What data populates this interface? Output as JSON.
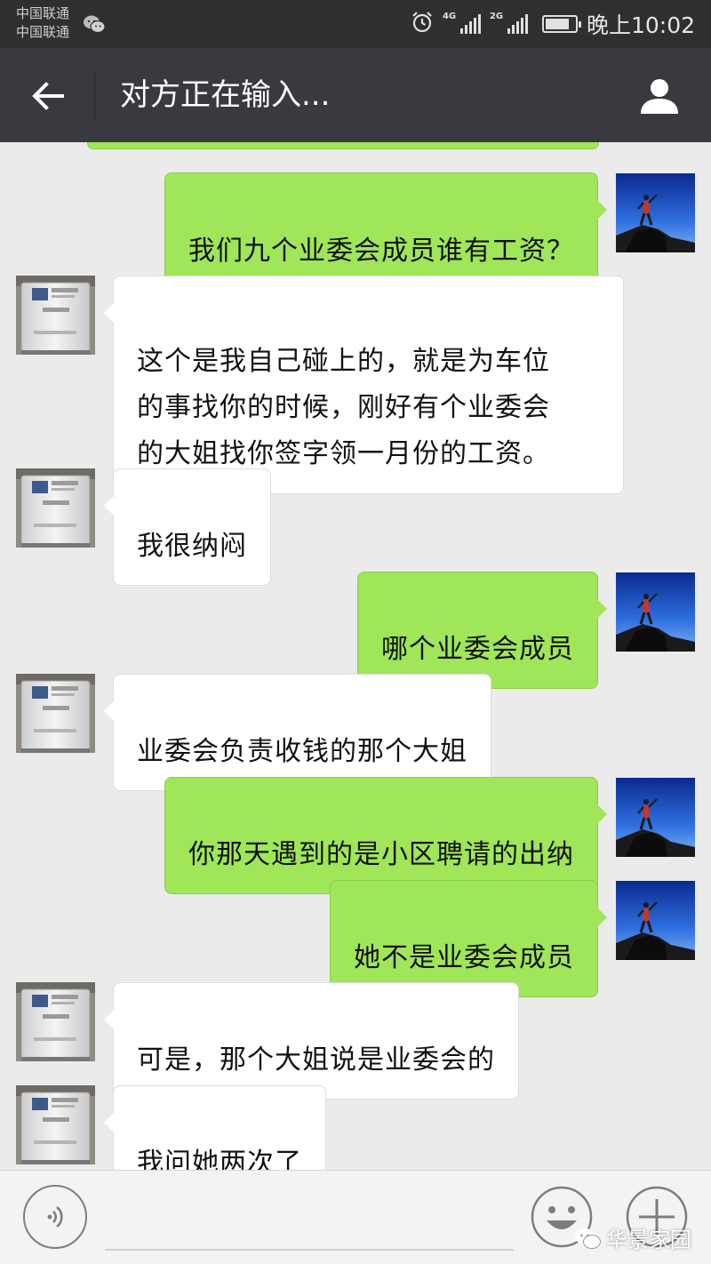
{
  "status_bar": {
    "carrier_1": "中国联通",
    "carrier_2": "中国联通",
    "signal_1_label": "4G",
    "signal_2_label": "2G",
    "time": "晚上10:02"
  },
  "header": {
    "title": "对方正在输入..."
  },
  "messages": [
    {
      "from": "me",
      "text": "我们九个业委会成员谁有工资？"
    },
    {
      "from": "other",
      "text": "这个是我自己碰上的，就是为车位\n的事找你的时候，刚好有个业委会\n的大姐找你签字领一月份的工资。"
    },
    {
      "from": "other",
      "text": "我很纳闷"
    },
    {
      "from": "me",
      "text": "哪个业委会成员"
    },
    {
      "from": "other",
      "text": "业委会负责收钱的那个大姐"
    },
    {
      "from": "me",
      "text": "你那天遇到的是小区聘请的出纳"
    },
    {
      "from": "me",
      "text": "她不是业委会成员"
    },
    {
      "from": "other",
      "text": "可是，那个大姐说是业委会的"
    },
    {
      "from": "other",
      "text": "我问她两次了"
    }
  ],
  "watermark": "华景家园",
  "colors": {
    "status_bar_bg": "#2e2f30",
    "header_bg": "#393a3f",
    "chat_bg": "#ebebeb",
    "outgoing_bubble": "#9fe658",
    "incoming_bubble": "#ffffff"
  },
  "icons": {
    "back": "back-arrow-icon",
    "user": "user-profile-icon",
    "voice": "voice-icon",
    "emoji": "emoji-icon",
    "plus": "plus-icon",
    "alarm": "alarm-icon",
    "battery": "battery-icon",
    "wechat": "wechat-icon"
  }
}
